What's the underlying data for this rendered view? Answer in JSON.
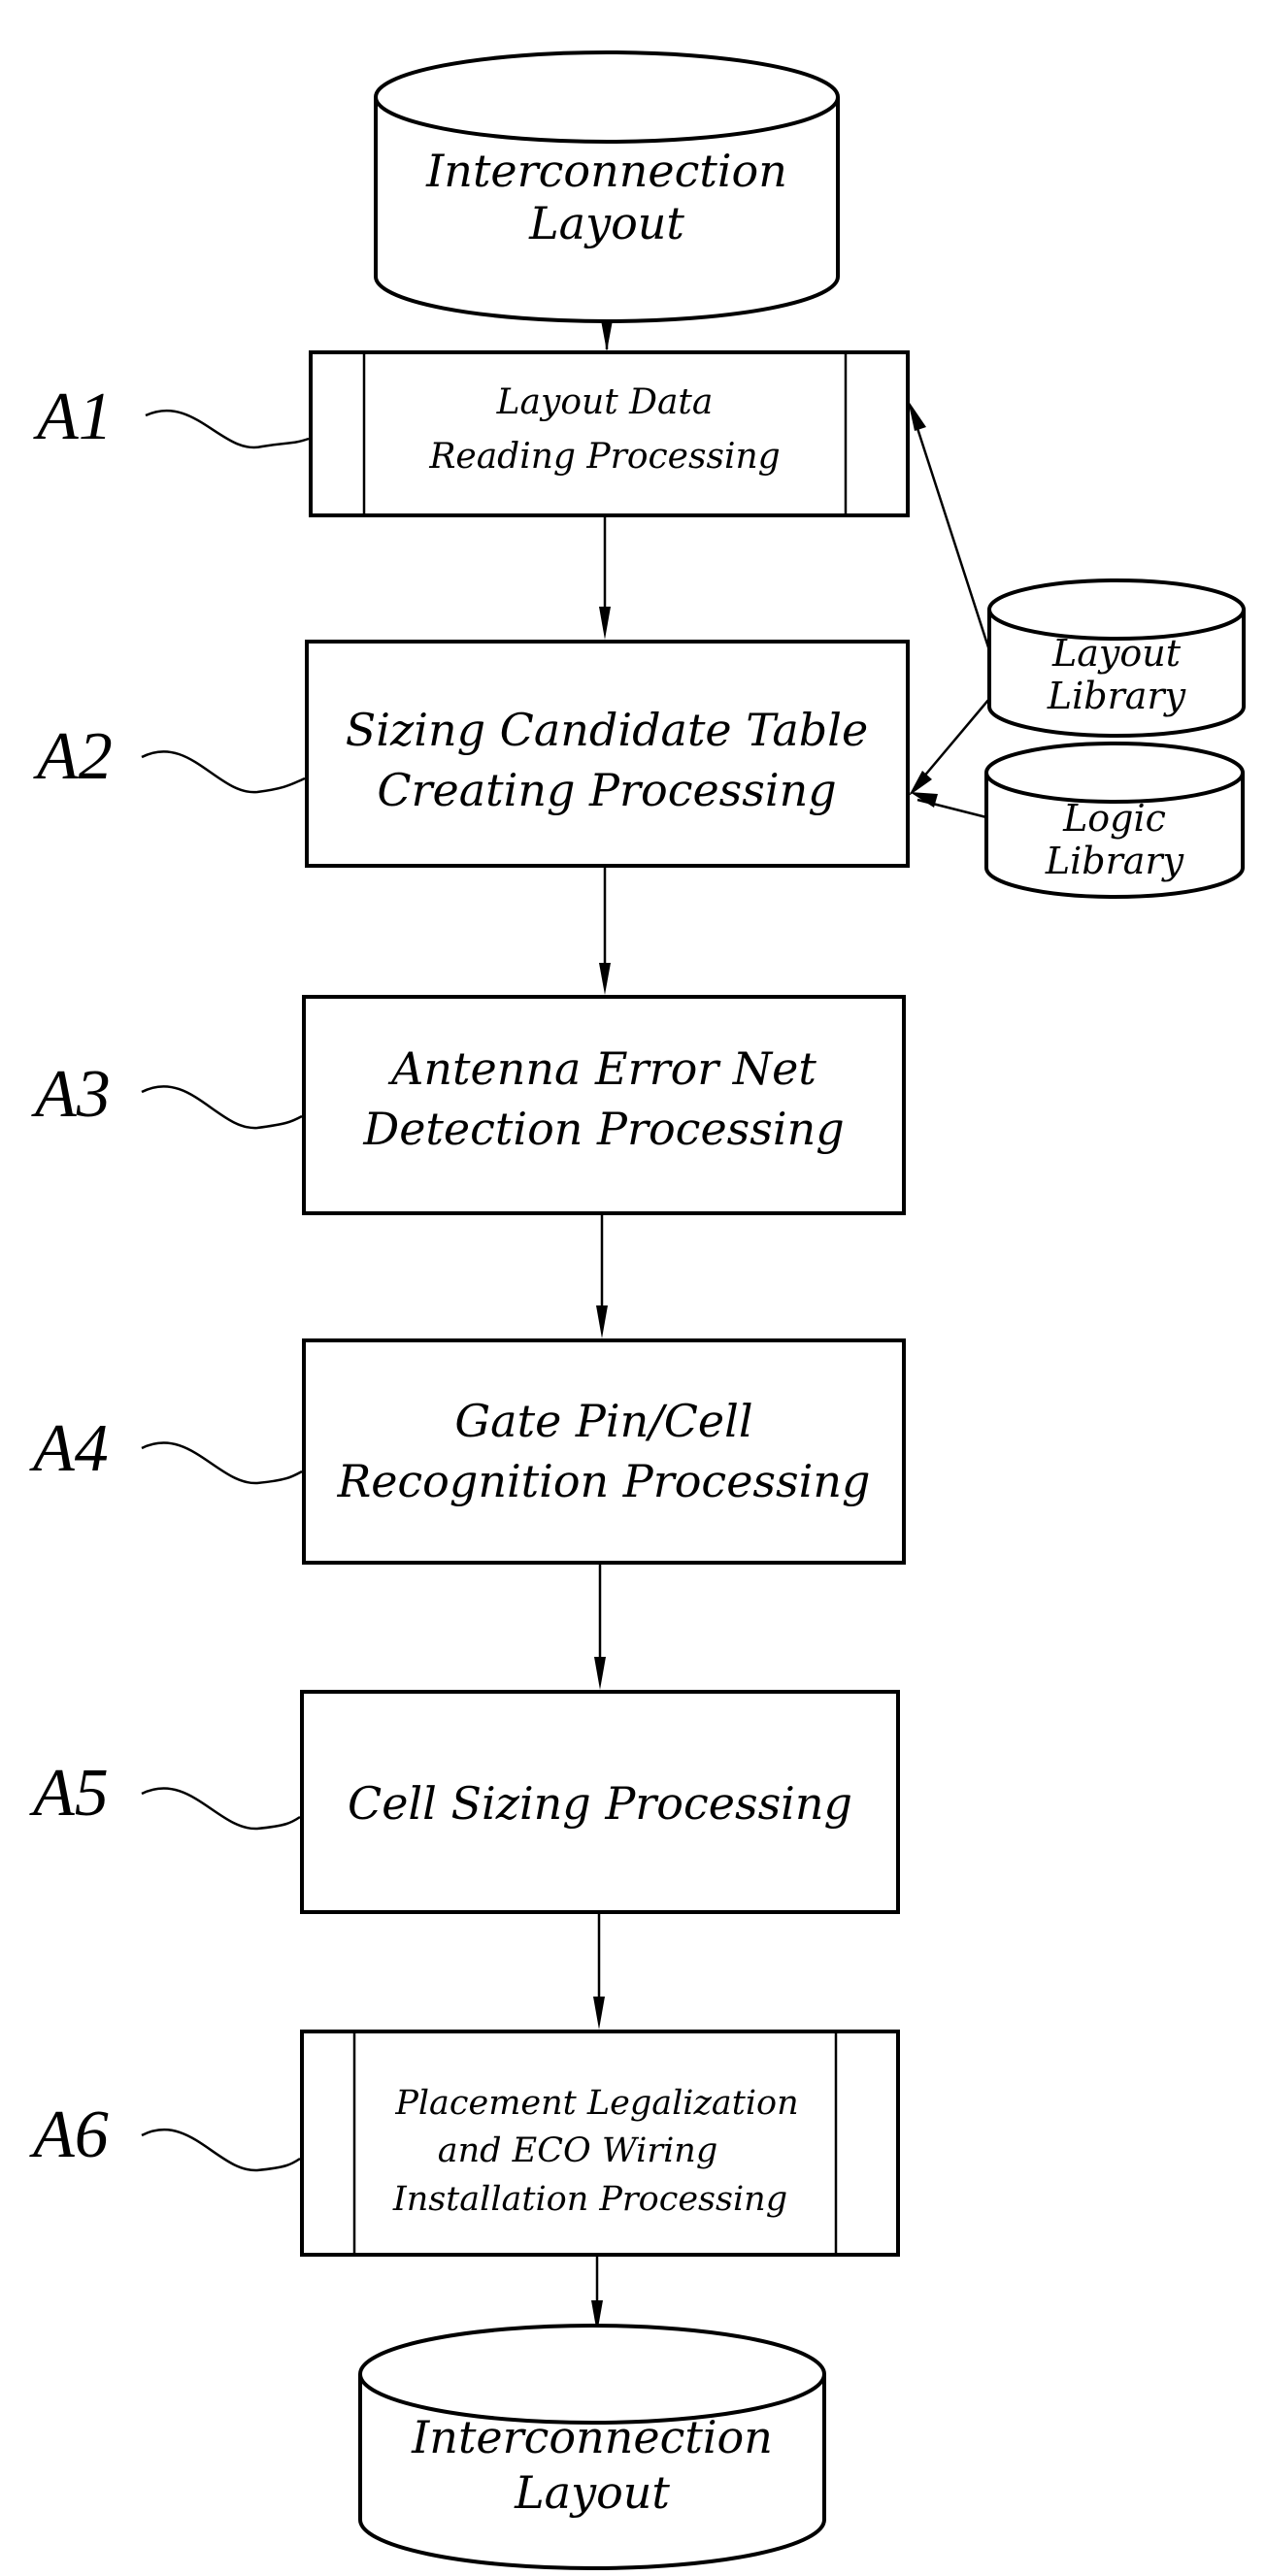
{
  "diagram": {
    "type": "flowchart",
    "start": {
      "label_lines": [
        "Interconnection",
        "Layout"
      ],
      "shape": "database"
    },
    "steps": [
      {
        "id": "A1",
        "label_lines": [
          "Layout Data",
          "Reading Processing"
        ],
        "shape": "predefined-process"
      },
      {
        "id": "A2",
        "label_lines": [
          "Sizing Candidate Table",
          "Creating Processing"
        ],
        "shape": "process"
      },
      {
        "id": "A3",
        "label_lines": [
          "Antenna Error Net",
          "Detection Processing"
        ],
        "shape": "process"
      },
      {
        "id": "A4",
        "label_lines": [
          "Gate Pin/Cell",
          "Recognition Processing"
        ],
        "shape": "process"
      },
      {
        "id": "A5",
        "label_lines": [
          "Cell Sizing Processing"
        ],
        "shape": "process"
      },
      {
        "id": "A6",
        "label_lines": [
          "Placement Legalization",
          "and ECO Wiring",
          "Installation Processing"
        ],
        "shape": "predefined-process"
      }
    ],
    "libraries": [
      {
        "label_lines": [
          "Layout",
          "Library"
        ],
        "shape": "database",
        "feeds": [
          "A1",
          "A2"
        ]
      },
      {
        "label_lines": [
          "Logic",
          "Library"
        ],
        "shape": "database",
        "feeds": [
          "A2"
        ]
      }
    ],
    "end": {
      "label_lines": [
        "Interconnection",
        "Layout"
      ],
      "shape": "database"
    }
  }
}
